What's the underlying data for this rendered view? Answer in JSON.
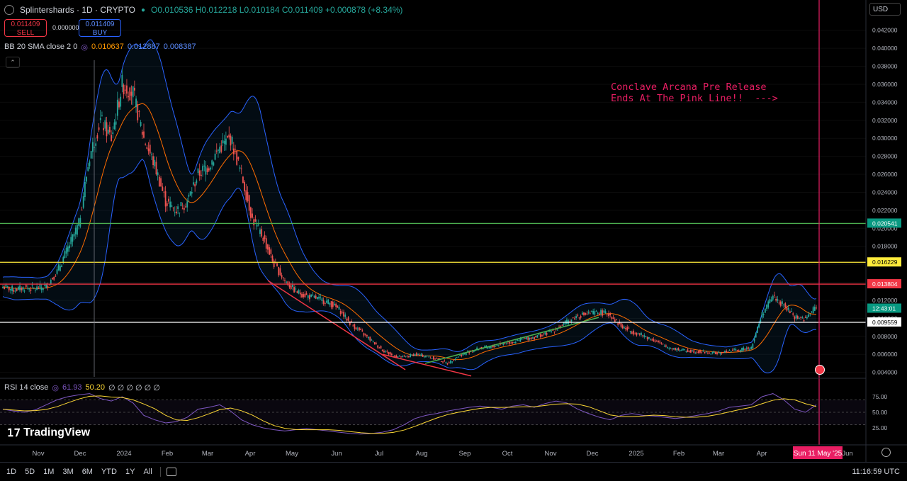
{
  "header": {
    "symbol": "Splintershards · 1D · CRYPTO",
    "ohlc": "O0.010536 H0.012218 L0.010184 C0.011409 +0.000878 (+8.34%)"
  },
  "trade": {
    "sell_price": "0.011409",
    "sell_label": "SELL",
    "spread": "0.000000",
    "buy_price": "0.011409",
    "buy_label": "BUY"
  },
  "bb": {
    "label": "BB 20 SMA close 2 0",
    "basis": "0.010637",
    "upper": "0.012887",
    "lower": "0.008387"
  },
  "annotation": "Conclave Arcana Pre Release\nEnds At The Pink Line!!  --->",
  "rsi": {
    "label": "RSI 14 close",
    "value": "61.93",
    "ma": "50.20",
    "extra": "∅ ∅ ∅ ∅ ∅ ∅"
  },
  "logo": "TradingView",
  "currency": "USD",
  "price_axis": {
    "ticks": [
      "0.042000",
      "0.040000",
      "0.038000",
      "0.036000",
      "0.034000",
      "0.032000",
      "0.030000",
      "0.028000",
      "0.026000",
      "0.024000",
      "0.022000",
      "0.020000",
      "0.018000",
      "0.016000",
      "0.014000",
      "0.012000",
      "0.010000",
      "0.008000",
      "0.006000",
      "0.004000"
    ],
    "rsi_ticks": [
      "75.00",
      "50.00",
      "25.00"
    ],
    "badges": [
      {
        "label": "0.020541",
        "bg": "#089981",
        "fg": "#ffffff"
      },
      {
        "label": "0.016229",
        "bg": "#ffeb3b",
        "fg": "#000000"
      },
      {
        "label": "0.013804",
        "bg": "#f23645",
        "fg": "#ffffff"
      },
      {
        "label": "12:43:01",
        "bg": "#089981",
        "fg": "#ffffff"
      },
      {
        "label": "0.009559",
        "bg": "#ffffff",
        "fg": "#000000"
      }
    ]
  },
  "time_axis": {
    "labels": [
      "Nov",
      "Dec",
      "2024",
      "Feb",
      "Mar",
      "Apr",
      "May",
      "Jun",
      "Jul",
      "Aug",
      "Sep",
      "Oct",
      "Nov",
      "Dec",
      "2025",
      "Feb",
      "Mar",
      "Apr",
      "Jun"
    ],
    "cursor_label": "Sun 11 May '25"
  },
  "bottom": {
    "ranges": [
      "1D",
      "5D",
      "1M",
      "3M",
      "6M",
      "YTD",
      "1Y",
      "All"
    ],
    "clock": "11:16:59 UTC"
  },
  "colors": {
    "up": "#26a69a",
    "down": "#ef5350",
    "pink": "#e91e63",
    "bb_band": "#2962ff",
    "bb_basis": "#ff6d00",
    "rsi": "#7e57c2",
    "rsi_ma": "#fdd835"
  },
  "chart_data": {
    "type": "candlestick",
    "symbol": "Splintershards",
    "timeframe": "1D",
    "ylim": [
      0.0035,
      0.043
    ],
    "x": [
      "2023-10-20",
      "2023-10-27",
      "2023-11-03",
      "2023-11-10",
      "2023-11-17",
      "2023-11-24",
      "2023-12-01",
      "2023-12-08",
      "2023-12-15",
      "2023-12-22",
      "2023-12-29",
      "2024-01-05",
      "2024-01-12",
      "2024-01-19",
      "2024-01-26",
      "2024-02-02",
      "2024-02-09",
      "2024-02-16",
      "2024-02-23",
      "2024-03-01",
      "2024-03-08",
      "2024-03-15",
      "2024-03-22",
      "2024-03-29",
      "2024-04-05",
      "2024-04-12",
      "2024-04-19",
      "2024-04-26",
      "2024-05-03",
      "2024-05-10",
      "2024-05-17",
      "2024-05-24",
      "2024-05-31",
      "2024-06-07",
      "2024-06-14",
      "2024-06-21",
      "2024-06-28",
      "2024-07-05",
      "2024-07-12",
      "2024-07-19",
      "2024-07-26",
      "2024-08-02",
      "2024-08-09",
      "2024-08-16",
      "2024-08-23",
      "2024-08-30",
      "2024-09-06",
      "2024-09-13",
      "2024-09-20",
      "2024-09-27",
      "2024-10-04",
      "2024-10-11",
      "2024-10-18",
      "2024-10-25",
      "2024-11-01",
      "2024-11-08",
      "2024-11-15",
      "2024-11-22",
      "2024-11-29",
      "2024-12-06",
      "2024-12-13",
      "2024-12-20",
      "2024-12-27",
      "2025-01-03",
      "2025-01-10",
      "2025-01-17",
      "2025-01-24",
      "2025-01-31",
      "2025-02-07",
      "2025-02-14",
      "2025-02-21",
      "2025-02-28",
      "2025-03-07",
      "2025-03-14",
      "2025-03-21",
      "2025-03-28",
      "2025-04-04",
      "2025-04-11",
      "2025-04-18",
      "2025-04-25",
      "2025-05-02",
      "2025-05-09"
    ],
    "close": [
      0.0135,
      0.0132,
      0.0134,
      0.0133,
      0.0136,
      0.0152,
      0.0178,
      0.0205,
      0.028,
      0.032,
      0.03,
      0.036,
      0.035,
      0.03,
      0.027,
      0.023,
      0.022,
      0.023,
      0.026,
      0.027,
      0.029,
      0.03,
      0.026,
      0.021,
      0.019,
      0.016,
      0.0142,
      0.013,
      0.0125,
      0.0122,
      0.0118,
      0.011,
      0.0095,
      0.0085,
      0.0075,
      0.0065,
      0.0058,
      0.0057,
      0.006,
      0.0058,
      0.0055,
      0.005,
      0.0058,
      0.0063,
      0.0067,
      0.0068,
      0.0072,
      0.0074,
      0.0077,
      0.0079,
      0.0083,
      0.0088,
      0.0096,
      0.0103,
      0.0105,
      0.0107,
      0.0104,
      0.0091,
      0.0085,
      0.0081,
      0.0076,
      0.0069,
      0.0066,
      0.0064,
      0.0063,
      0.0062,
      0.0061,
      0.0064,
      0.0065,
      0.0068,
      0.0105,
      0.0125,
      0.0114,
      0.0102,
      0.0099,
      0.0114
    ],
    "horizontal_lines": [
      {
        "price": 0.020541,
        "color": "#4caf50"
      },
      {
        "price": 0.016229,
        "color": "#ffeb3b"
      },
      {
        "price": 0.013804,
        "color": "#f23645"
      },
      {
        "price": 0.009559,
        "color": "#ffffff"
      }
    ],
    "rsi_levels": [
      70,
      50,
      30
    ],
    "rsi": [
      55,
      52,
      50,
      54,
      62,
      70,
      75,
      78,
      80,
      72,
      68,
      75,
      65,
      45,
      38,
      33,
      35,
      42,
      55,
      58,
      62,
      52,
      38,
      30,
      25,
      22,
      20,
      22,
      24,
      22,
      20,
      18,
      16,
      15,
      16,
      18,
      22,
      30,
      40,
      45,
      48,
      52,
      55,
      58,
      60,
      58,
      55,
      60,
      62,
      58,
      64,
      68,
      65,
      55,
      48,
      42,
      38,
      45,
      48,
      45,
      44,
      42,
      40,
      42,
      45,
      48,
      52,
      58,
      60,
      62,
      75,
      80,
      70,
      55,
      50,
      62
    ]
  }
}
